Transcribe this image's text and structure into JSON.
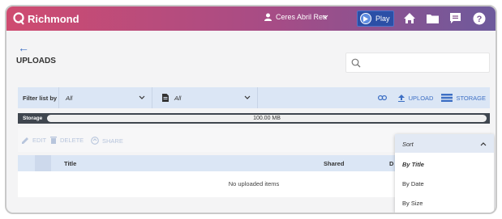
{
  "brand": {
    "name": "Richmond"
  },
  "header": {
    "user_name": "Ceres Abril Rea",
    "play_label": "Play"
  },
  "page": {
    "title": "UPLOADS"
  },
  "search": {
    "placeholder": ""
  },
  "filter": {
    "label": "Filter list by",
    "type_value": "All",
    "doc_value": "All"
  },
  "actions": {
    "upload_label": "UPLOAD",
    "storage_label": "STORAGE"
  },
  "storage": {
    "label": "Storage",
    "used_text": "100.00 MB"
  },
  "toolbar": {
    "edit_label": "EDIT",
    "delete_label": "DELETE",
    "share_label": "SHARE"
  },
  "table": {
    "columns": [
      "Title",
      "Shared",
      "D"
    ],
    "empty_text": "No uploaded items"
  },
  "sort": {
    "label": "Sort",
    "options": [
      "By Title",
      "By Date",
      "By Size"
    ],
    "selected": "By Title"
  },
  "colors": {
    "header_gradient_start": "#cf4b70",
    "header_gradient_end": "#6d5a9c",
    "accent_blue": "#3d6fc4",
    "filter_bg": "#dbe6f5",
    "storage_bg": "#3f464f"
  }
}
